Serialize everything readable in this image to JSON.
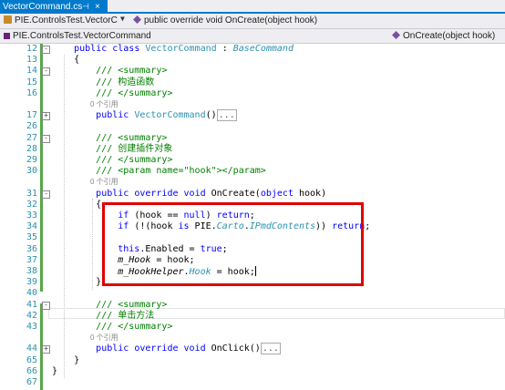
{
  "tab": {
    "title": "VectorCommand.cs",
    "pin": "⊣",
    "close": "×"
  },
  "nav": {
    "class_combo": "PIE.ControlsTest.VectorC",
    "member_combo": "public override void OnCreate(object hook)",
    "project_combo": "PIE.ControlsTest.VectorCommand",
    "member_combo2": "OnCreate(object hook)"
  },
  "lines": [
    {
      "n": "12",
      "t": "    public class VectorCommand : BaseCommand"
    },
    {
      "n": "13",
      "t": "    {"
    },
    {
      "n": "14",
      "t": "        /// <summary>"
    },
    {
      "n": "15",
      "t": "        /// 构造函数"
    },
    {
      "n": "16",
      "t": "        /// </summary>"
    },
    {
      "n": "",
      "t": "0 个引用"
    },
    {
      "n": "17",
      "t": "        public VectorCommand()..."
    },
    {
      "n": "26",
      "t": ""
    },
    {
      "n": "27",
      "t": "        /// <summary>"
    },
    {
      "n": "28",
      "t": "        /// 创建插件对象"
    },
    {
      "n": "29",
      "t": "        /// </summary>"
    },
    {
      "n": "30",
      "t": "        /// <param name=\"hook\"></param>"
    },
    {
      "n": "",
      "t": "0 个引用"
    },
    {
      "n": "31",
      "t": "        public override void OnCreate(object hook)"
    },
    {
      "n": "32",
      "t": "        {"
    },
    {
      "n": "33",
      "t": "            if (hook == null) return;"
    },
    {
      "n": "34",
      "t": "            if (!(hook is PIE.Carto.IPmdContents)) return;"
    },
    {
      "n": "35",
      "t": ""
    },
    {
      "n": "36",
      "t": "            this.Enabled = true;"
    },
    {
      "n": "37",
      "t": "            m_Hook = hook;"
    },
    {
      "n": "38",
      "t": "            m_HookHelper.Hook = hook;"
    },
    {
      "n": "39",
      "t": "        }"
    },
    {
      "n": "40",
      "t": ""
    },
    {
      "n": "41",
      "t": "        /// <summary>"
    },
    {
      "n": "42",
      "t": "        /// 单击方法"
    },
    {
      "n": "43",
      "t": "        /// </summary>"
    },
    {
      "n": "",
      "t": "0 个引用"
    },
    {
      "n": "44",
      "t": "        public override void OnClick()..."
    },
    {
      "n": "65",
      "t": "    }"
    },
    {
      "n": "66",
      "t": "}"
    },
    {
      "n": "67",
      "t": ""
    }
  ],
  "colors": {
    "accent": "#007acc",
    "keyword": "#0000ff",
    "type": "#2b91af",
    "comment": "#008000",
    "highlight": "#e00000"
  }
}
